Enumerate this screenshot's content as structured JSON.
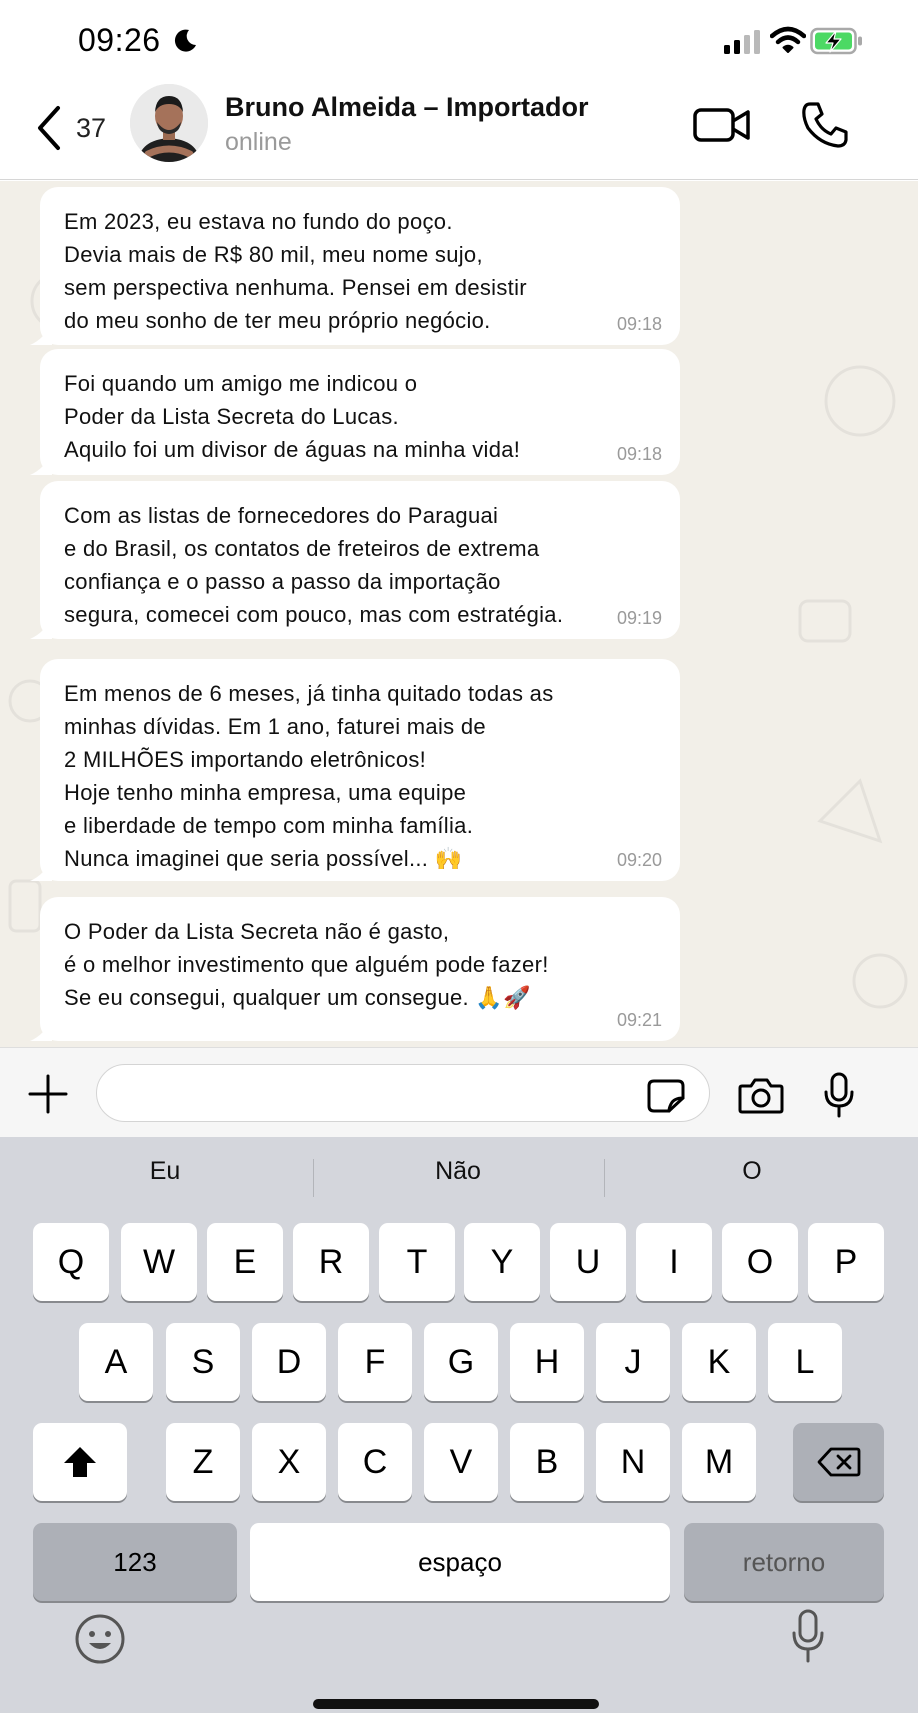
{
  "status_bar": {
    "time": "09:26",
    "icons": [
      "moon-icon",
      "signal-icon",
      "wifi-icon",
      "battery-charging-icon"
    ]
  },
  "header": {
    "back_count": "37",
    "contact_name": "Bruno Almeida – Importador",
    "contact_status": "online",
    "icons": [
      "chevron-left-icon",
      "video-camera-icon",
      "phone-icon"
    ]
  },
  "messages": [
    {
      "text": "Em 2023, eu estava no fundo do poço.\nDevia mais de R$ 80 mil, meu nome sujo,\nsem perspectiva nenhuma. Pensei em desistir\ndo meu sonho de ter meu próprio negócio.",
      "time": "09:18"
    },
    {
      "text": "Foi quando um amigo me indicou o\nPoder da Lista Secreta do Lucas.\nAquilo foi um divisor de águas na minha vida!",
      "time": "09:18"
    },
    {
      "text": "Com as listas de fornecedores do Paraguai\ne do Brasil, os contatos de freteiros de extrema\nconfiança e o passo a passo da importação\nsegura, comecei com pouco, mas com estratégia.",
      "time": "09:19"
    },
    {
      "text": "Em menos de 6 meses, já tinha quitado todas as\nminhas dívidas. Em 1 ano, faturei mais de\n2 MILHÕES importando eletrônicos!\nHoje tenho minha empresa, uma equipe\ne liberdade de tempo com minha família.\nNunca imaginei que seria possível... 🙌",
      "time": "09:20"
    },
    {
      "text": "O Poder da Lista Secreta não é gasto,\né o melhor investimento que alguém pode fazer!\nSe eu consegui, qualquer um consegue. 🙏🚀",
      "time": "09:21"
    }
  ],
  "input_bar": {
    "message_value": "",
    "icons": [
      "plus-icon",
      "sticker-icon",
      "camera-icon",
      "microphone-icon"
    ]
  },
  "keyboard": {
    "suggestions": [
      "Eu",
      "Não",
      "O"
    ],
    "row1": [
      "Q",
      "W",
      "E",
      "R",
      "T",
      "Y",
      "U",
      "I",
      "O",
      "P"
    ],
    "row2": [
      "A",
      "S",
      "D",
      "F",
      "G",
      "H",
      "J",
      "K",
      "L"
    ],
    "row3": [
      "Z",
      "X",
      "C",
      "V",
      "B",
      "N",
      "M"
    ],
    "numbers_label": "123",
    "space_label": "espaço",
    "return_label": "retorno",
    "icons": [
      "shift-icon",
      "backspace-icon",
      "emoji-icon",
      "dictation-icon"
    ]
  },
  "colors": {
    "chat_background": "#f2efe8",
    "bubble": "#ffffff",
    "keyboard": "#d4d6dc",
    "battery_fill": "#4cd964"
  }
}
